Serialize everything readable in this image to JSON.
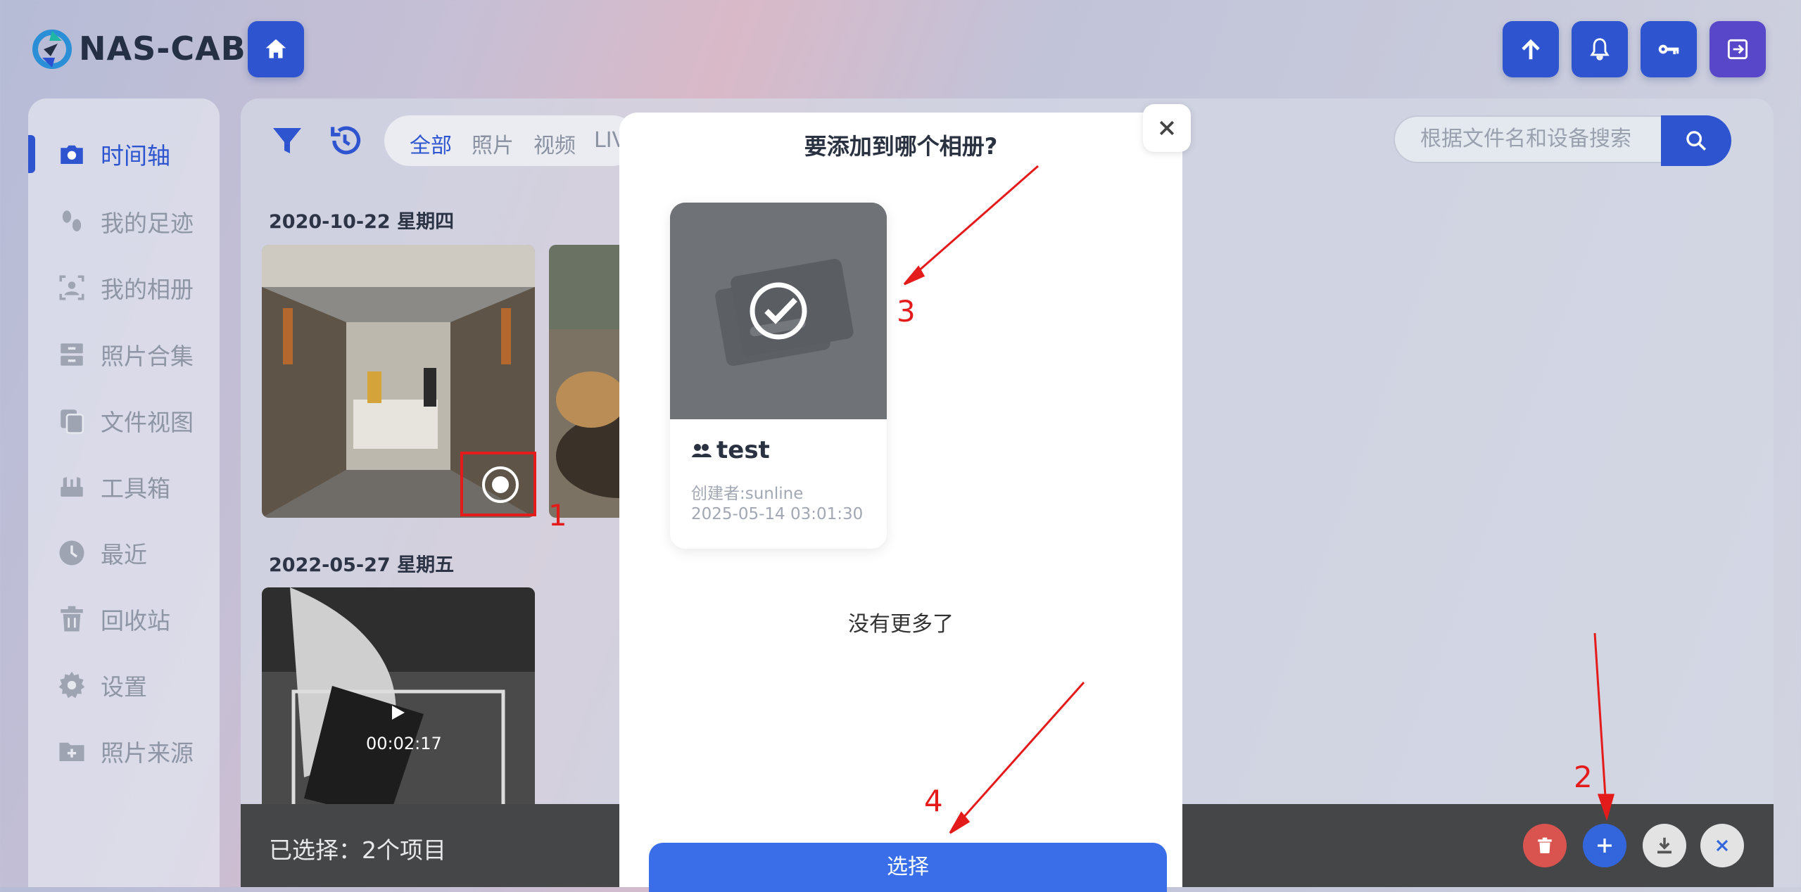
{
  "app": {
    "logo_text": "NAS-CAB"
  },
  "header": {
    "home_icon": "home-icon",
    "actions": [
      {
        "icon": "upload-arrow-icon"
      },
      {
        "icon": "bell-icon"
      },
      {
        "icon": "key-icon"
      },
      {
        "icon": "logout-icon"
      }
    ]
  },
  "sidebar": {
    "items": [
      {
        "label": "时间轴",
        "icon": "camera-icon",
        "active": true
      },
      {
        "label": "我的足迹",
        "icon": "footprints-icon"
      },
      {
        "label": "我的相册",
        "icon": "person-frame-icon"
      },
      {
        "label": "照片合集",
        "icon": "drawer-icon"
      },
      {
        "label": "文件视图",
        "icon": "copy-icon"
      },
      {
        "label": "工具箱",
        "icon": "toolbox-icon"
      },
      {
        "label": "最近",
        "icon": "clock-icon"
      },
      {
        "label": "回收站",
        "icon": "trash-icon"
      },
      {
        "label": "设置",
        "icon": "gear-icon"
      },
      {
        "label": "照片来源",
        "icon": "folder-plus-icon"
      }
    ]
  },
  "toolbar": {
    "tabs": [
      "全部",
      "照片",
      "视频",
      "LIV"
    ],
    "search_placeholder": "根据文件名和设备搜索"
  },
  "timeline": {
    "groups": [
      {
        "date": "2020-10-22 星期四"
      },
      {
        "date": "2022-05-27 星期五",
        "video_duration": "00:02:17"
      }
    ]
  },
  "selection_bar": {
    "text": "已选择：2个项目",
    "colors": {
      "delete": "#d9534f",
      "add": "#3366dd",
      "download": "#e3e3e3",
      "close": "#e3e3e3"
    }
  },
  "modal": {
    "title": "要添加到哪个相册?",
    "album": {
      "name": "test",
      "creator": "创建者:sunline",
      "created_at": "2025-05-14 03:01:30"
    },
    "no_more": "没有更多了",
    "select_button": "选择"
  },
  "annotations": [
    "1",
    "2",
    "3",
    "4"
  ]
}
